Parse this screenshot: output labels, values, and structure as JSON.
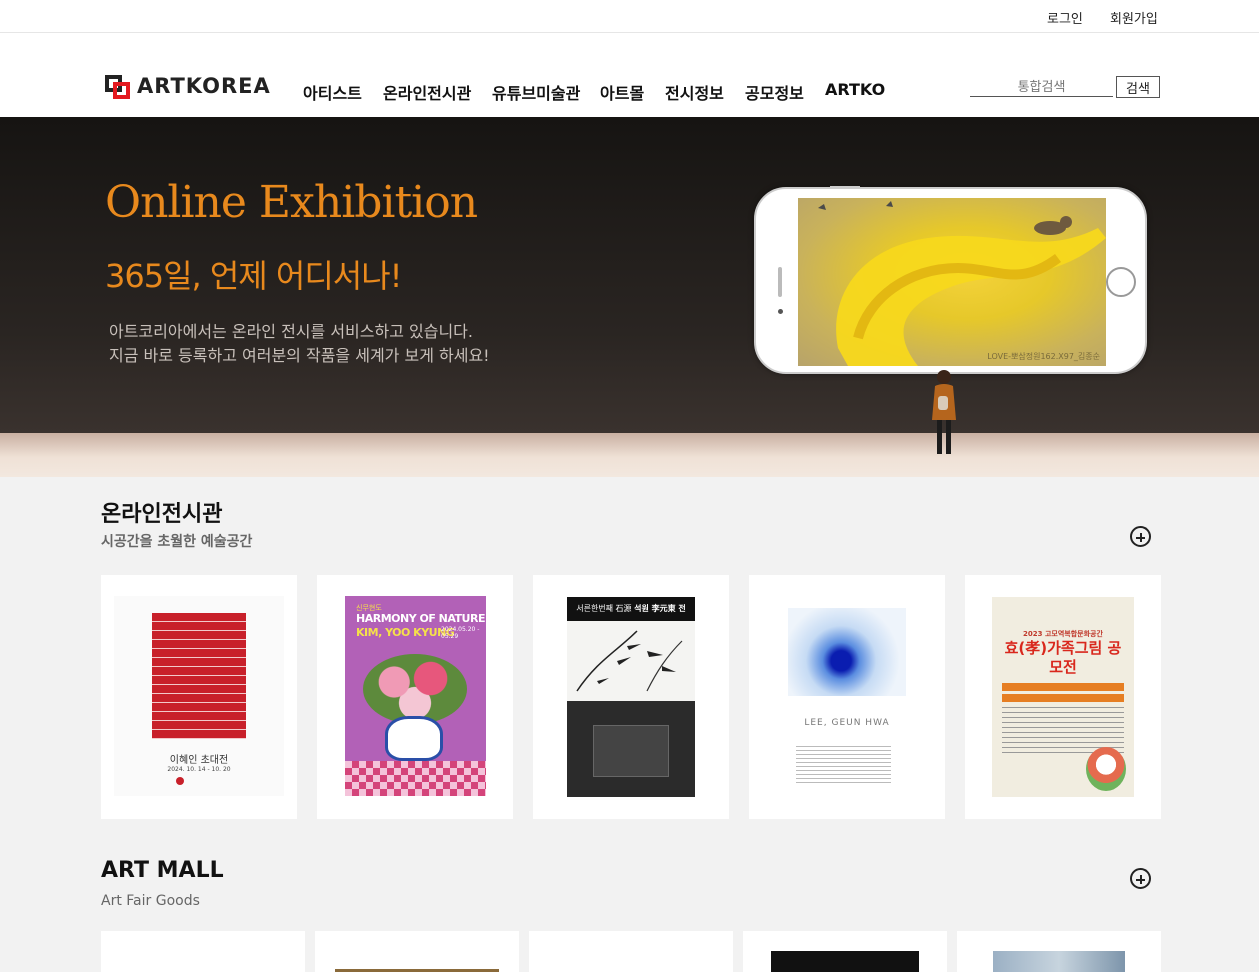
{
  "topbar": {
    "login": "로그인",
    "signup": "회원가입"
  },
  "header": {
    "logo_text": "ARTKOREA",
    "nav": [
      "아티스트",
      "온라인전시관",
      "유튜브미술관",
      "아트몰",
      "전시정보",
      "공모정보",
      "ARTKO"
    ],
    "search_placeholder": "통합검색",
    "search_button": "검색"
  },
  "hero": {
    "title": "Online Exhibition",
    "subtitle": "365일, 언제 어디서나!",
    "desc_line1": "아트코리아에서는  온라인 전시를 서비스하고 있습니다.",
    "desc_line2": "지금 바로 등록하고  여러분의 작품을 세계가 보게 하세요!",
    "phone_caption": "LOVE-뽀삼정원162.X97_김종순"
  },
  "online": {
    "title": "온라인전시관",
    "subtitle": "시공간을 초월한 예술공간",
    "posters": [
      {
        "caption": "이혜인  초대전",
        "date": "2024. 10. 14 - 10. 20"
      },
      {
        "tag": "신무현도",
        "title": "HARMONY OF NATURE",
        "artist": "KIM, YOO KYUNG",
        "dates": "2024.05.20 - 05.29"
      },
      {
        "title": "석원 李元東 전",
        "top": "서른한번째 石源"
      },
      {
        "artist": "LEE, GEUN HWA"
      },
      {
        "year": "2023 고모역복합문화공간",
        "title": "효(孝)가족그림 공모전"
      }
    ]
  },
  "mall": {
    "title": "ART MALL",
    "subtitle": "Art Fair Goods"
  }
}
